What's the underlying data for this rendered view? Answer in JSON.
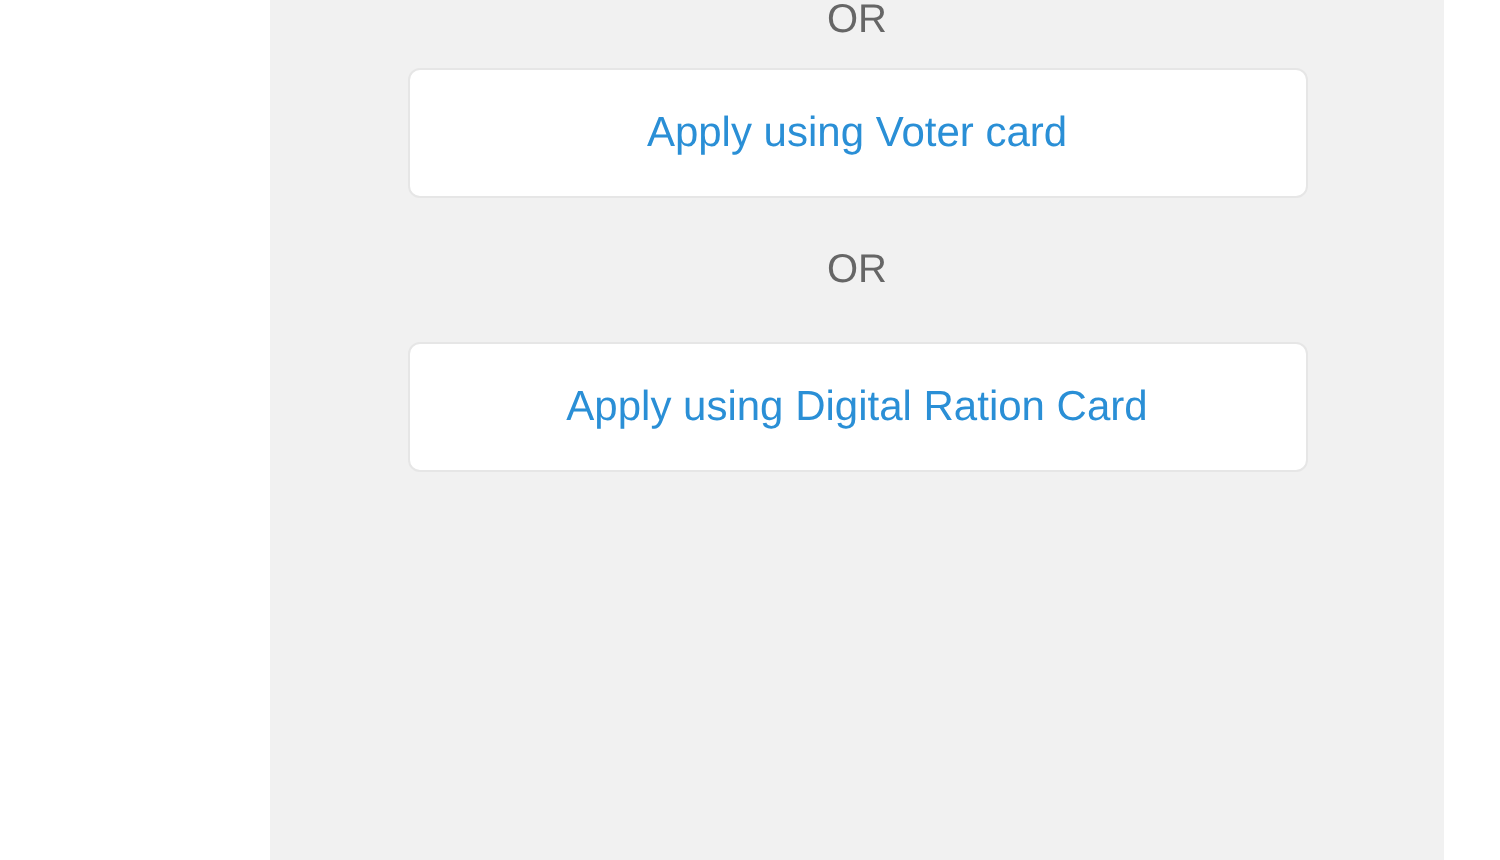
{
  "items": [
    {
      "kind": "separator",
      "text": "OR"
    },
    {
      "kind": "button",
      "label": "Apply using Voter card"
    },
    {
      "kind": "separator",
      "text": "OR"
    },
    {
      "kind": "button",
      "label": "Apply using Digital Ration Card"
    }
  ]
}
